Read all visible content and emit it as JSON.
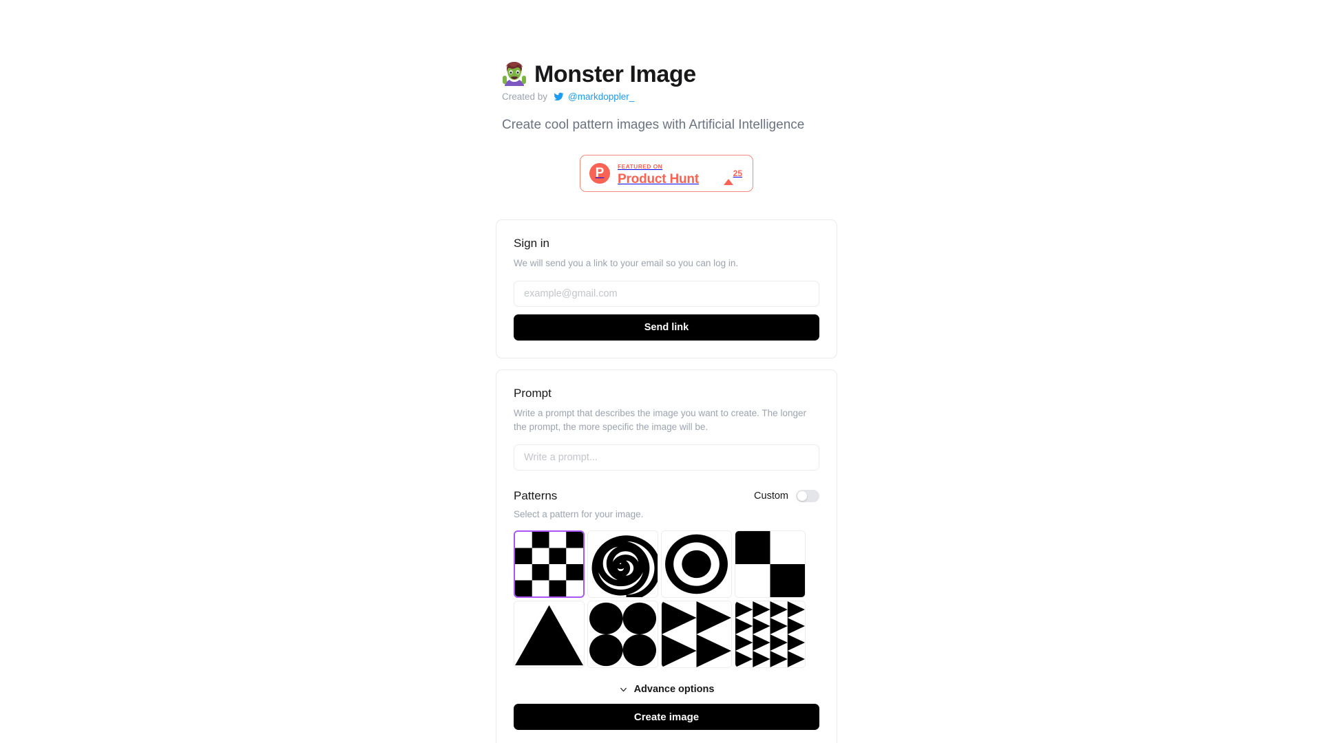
{
  "header": {
    "emoji_name": "zombie-woman-emoji",
    "title": "Monster Image",
    "created_by_label": "Created by",
    "twitter_handle": "@markdoppler_",
    "subtitle": "Create cool pattern images with Artificial Intelligence"
  },
  "product_hunt": {
    "logo_letter": "P",
    "featured_label": "FEATURED ON",
    "name": "Product Hunt",
    "upvote_count": "25",
    "accent_color": "#f96354",
    "border_color": "#f08a7e"
  },
  "signin": {
    "title": "Sign in",
    "description": "We will send you a link to your email so you can log in.",
    "email_placeholder": "example@gmail.com",
    "email_value": "",
    "submit_label": "Send link"
  },
  "prompt": {
    "title": "Prompt",
    "description": "Write a prompt that describes the image you want to create. The longer the prompt, the more specific the image will be.",
    "input_placeholder": "Write a prompt...",
    "input_value": ""
  },
  "patterns": {
    "title": "Patterns",
    "description": "Select a pattern for your image.",
    "custom_label": "Custom",
    "custom_enabled": false,
    "selected_index": 0,
    "items": [
      {
        "name": "checkerboard",
        "label": "Checkerboard"
      },
      {
        "name": "spiral",
        "label": "Spiral"
      },
      {
        "name": "concentric-rings",
        "label": "Concentric rings"
      },
      {
        "name": "quad-checker",
        "label": "Quad checker"
      },
      {
        "name": "triangle",
        "label": "Triangle"
      },
      {
        "name": "four-circles",
        "label": "Four circles"
      },
      {
        "name": "four-triangles",
        "label": "Four triangles"
      },
      {
        "name": "triangle-grid",
        "label": "Triangle grid"
      }
    ],
    "selected_border_color": "#a855f7"
  },
  "footer": {
    "advance_options_label": "Advance options",
    "create_label": "Create image"
  }
}
